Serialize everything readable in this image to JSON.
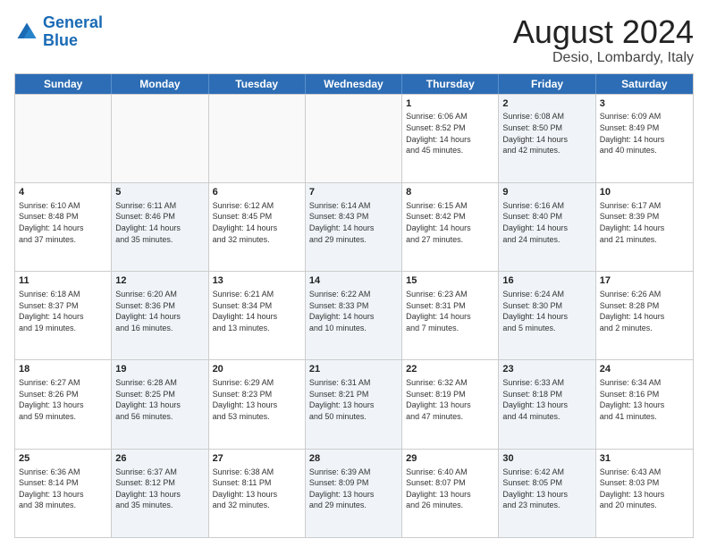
{
  "header": {
    "logo_line1": "General",
    "logo_line2": "Blue",
    "month": "August 2024",
    "location": "Desio, Lombardy, Italy"
  },
  "weekdays": [
    "Sunday",
    "Monday",
    "Tuesday",
    "Wednesday",
    "Thursday",
    "Friday",
    "Saturday"
  ],
  "rows": [
    [
      {
        "day": "",
        "info": "",
        "shaded": false,
        "empty": true
      },
      {
        "day": "",
        "info": "",
        "shaded": false,
        "empty": true
      },
      {
        "day": "",
        "info": "",
        "shaded": false,
        "empty": true
      },
      {
        "day": "",
        "info": "",
        "shaded": false,
        "empty": true
      },
      {
        "day": "1",
        "info": "Sunrise: 6:06 AM\nSunset: 8:52 PM\nDaylight: 14 hours\nand 45 minutes.",
        "shaded": false,
        "empty": false
      },
      {
        "day": "2",
        "info": "Sunrise: 6:08 AM\nSunset: 8:50 PM\nDaylight: 14 hours\nand 42 minutes.",
        "shaded": true,
        "empty": false
      },
      {
        "day": "3",
        "info": "Sunrise: 6:09 AM\nSunset: 8:49 PM\nDaylight: 14 hours\nand 40 minutes.",
        "shaded": false,
        "empty": false
      }
    ],
    [
      {
        "day": "4",
        "info": "Sunrise: 6:10 AM\nSunset: 8:48 PM\nDaylight: 14 hours\nand 37 minutes.",
        "shaded": false,
        "empty": false
      },
      {
        "day": "5",
        "info": "Sunrise: 6:11 AM\nSunset: 8:46 PM\nDaylight: 14 hours\nand 35 minutes.",
        "shaded": true,
        "empty": false
      },
      {
        "day": "6",
        "info": "Sunrise: 6:12 AM\nSunset: 8:45 PM\nDaylight: 14 hours\nand 32 minutes.",
        "shaded": false,
        "empty": false
      },
      {
        "day": "7",
        "info": "Sunrise: 6:14 AM\nSunset: 8:43 PM\nDaylight: 14 hours\nand 29 minutes.",
        "shaded": true,
        "empty": false
      },
      {
        "day": "8",
        "info": "Sunrise: 6:15 AM\nSunset: 8:42 PM\nDaylight: 14 hours\nand 27 minutes.",
        "shaded": false,
        "empty": false
      },
      {
        "day": "9",
        "info": "Sunrise: 6:16 AM\nSunset: 8:40 PM\nDaylight: 14 hours\nand 24 minutes.",
        "shaded": true,
        "empty": false
      },
      {
        "day": "10",
        "info": "Sunrise: 6:17 AM\nSunset: 8:39 PM\nDaylight: 14 hours\nand 21 minutes.",
        "shaded": false,
        "empty": false
      }
    ],
    [
      {
        "day": "11",
        "info": "Sunrise: 6:18 AM\nSunset: 8:37 PM\nDaylight: 14 hours\nand 19 minutes.",
        "shaded": false,
        "empty": false
      },
      {
        "day": "12",
        "info": "Sunrise: 6:20 AM\nSunset: 8:36 PM\nDaylight: 14 hours\nand 16 minutes.",
        "shaded": true,
        "empty": false
      },
      {
        "day": "13",
        "info": "Sunrise: 6:21 AM\nSunset: 8:34 PM\nDaylight: 14 hours\nand 13 minutes.",
        "shaded": false,
        "empty": false
      },
      {
        "day": "14",
        "info": "Sunrise: 6:22 AM\nSunset: 8:33 PM\nDaylight: 14 hours\nand 10 minutes.",
        "shaded": true,
        "empty": false
      },
      {
        "day": "15",
        "info": "Sunrise: 6:23 AM\nSunset: 8:31 PM\nDaylight: 14 hours\nand 7 minutes.",
        "shaded": false,
        "empty": false
      },
      {
        "day": "16",
        "info": "Sunrise: 6:24 AM\nSunset: 8:30 PM\nDaylight: 14 hours\nand 5 minutes.",
        "shaded": true,
        "empty": false
      },
      {
        "day": "17",
        "info": "Sunrise: 6:26 AM\nSunset: 8:28 PM\nDaylight: 14 hours\nand 2 minutes.",
        "shaded": false,
        "empty": false
      }
    ],
    [
      {
        "day": "18",
        "info": "Sunrise: 6:27 AM\nSunset: 8:26 PM\nDaylight: 13 hours\nand 59 minutes.",
        "shaded": false,
        "empty": false
      },
      {
        "day": "19",
        "info": "Sunrise: 6:28 AM\nSunset: 8:25 PM\nDaylight: 13 hours\nand 56 minutes.",
        "shaded": true,
        "empty": false
      },
      {
        "day": "20",
        "info": "Sunrise: 6:29 AM\nSunset: 8:23 PM\nDaylight: 13 hours\nand 53 minutes.",
        "shaded": false,
        "empty": false
      },
      {
        "day": "21",
        "info": "Sunrise: 6:31 AM\nSunset: 8:21 PM\nDaylight: 13 hours\nand 50 minutes.",
        "shaded": true,
        "empty": false
      },
      {
        "day": "22",
        "info": "Sunrise: 6:32 AM\nSunset: 8:19 PM\nDaylight: 13 hours\nand 47 minutes.",
        "shaded": false,
        "empty": false
      },
      {
        "day": "23",
        "info": "Sunrise: 6:33 AM\nSunset: 8:18 PM\nDaylight: 13 hours\nand 44 minutes.",
        "shaded": true,
        "empty": false
      },
      {
        "day": "24",
        "info": "Sunrise: 6:34 AM\nSunset: 8:16 PM\nDaylight: 13 hours\nand 41 minutes.",
        "shaded": false,
        "empty": false
      }
    ],
    [
      {
        "day": "25",
        "info": "Sunrise: 6:36 AM\nSunset: 8:14 PM\nDaylight: 13 hours\nand 38 minutes.",
        "shaded": false,
        "empty": false
      },
      {
        "day": "26",
        "info": "Sunrise: 6:37 AM\nSunset: 8:12 PM\nDaylight: 13 hours\nand 35 minutes.",
        "shaded": true,
        "empty": false
      },
      {
        "day": "27",
        "info": "Sunrise: 6:38 AM\nSunset: 8:11 PM\nDaylight: 13 hours\nand 32 minutes.",
        "shaded": false,
        "empty": false
      },
      {
        "day": "28",
        "info": "Sunrise: 6:39 AM\nSunset: 8:09 PM\nDaylight: 13 hours\nand 29 minutes.",
        "shaded": true,
        "empty": false
      },
      {
        "day": "29",
        "info": "Sunrise: 6:40 AM\nSunset: 8:07 PM\nDaylight: 13 hours\nand 26 minutes.",
        "shaded": false,
        "empty": false
      },
      {
        "day": "30",
        "info": "Sunrise: 6:42 AM\nSunset: 8:05 PM\nDaylight: 13 hours\nand 23 minutes.",
        "shaded": true,
        "empty": false
      },
      {
        "day": "31",
        "info": "Sunrise: 6:43 AM\nSunset: 8:03 PM\nDaylight: 13 hours\nand 20 minutes.",
        "shaded": false,
        "empty": false
      }
    ]
  ]
}
